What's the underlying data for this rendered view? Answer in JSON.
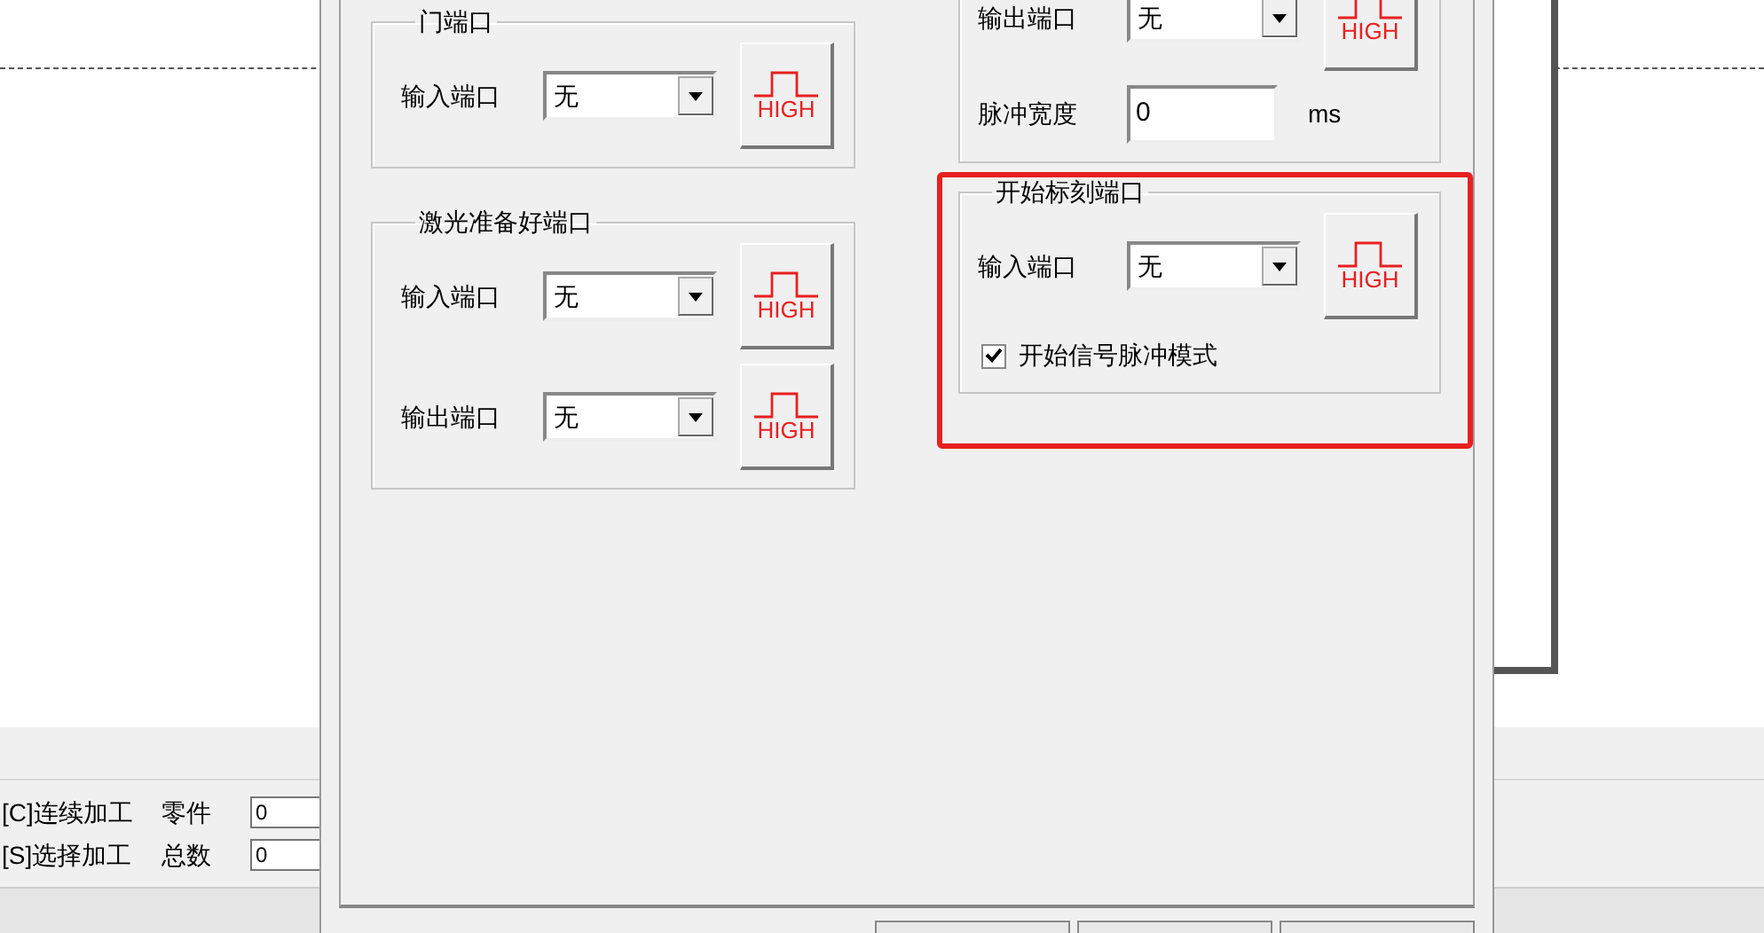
{
  "background": {
    "counters": [
      {
        "mode": "[C]连续加工",
        "label": "零件",
        "value": "0"
      },
      {
        "mode": "[S]选择加工",
        "label": "总数",
        "value": "0"
      }
    ]
  },
  "dialog": {
    "left_groups": [
      {
        "title": "门端口",
        "highlighted": false,
        "rows": [
          {
            "kind": "select",
            "label": "输入端口",
            "value": "无",
            "button": "HIGH"
          }
        ]
      },
      {
        "title": "激光准备好端口",
        "highlighted": false,
        "rows": [
          {
            "kind": "select",
            "label": "输入端口",
            "value": "无",
            "button": "HIGH"
          },
          {
            "kind": "select",
            "label": "输出端口",
            "value": "无",
            "button": "HIGH"
          }
        ]
      }
    ],
    "right_groups": [
      {
        "highlighted": false,
        "rows": [
          {
            "kind": "select",
            "label": "输出端口",
            "value": "无",
            "button": "HIGH"
          },
          {
            "kind": "input",
            "label": "脉冲宽度",
            "value": "0",
            "unit": "ms"
          }
        ]
      },
      {
        "title": "开始标刻端口",
        "highlighted": true,
        "rows": [
          {
            "kind": "select",
            "label": "输入端口",
            "value": "无",
            "button": "HIGH"
          },
          {
            "kind": "checkbox",
            "label": "开始信号脉冲模式",
            "checked": true
          }
        ]
      }
    ],
    "buttons": [
      {
        "kind": "button"
      },
      {
        "kind": "button"
      },
      {
        "kind": "button"
      }
    ]
  }
}
